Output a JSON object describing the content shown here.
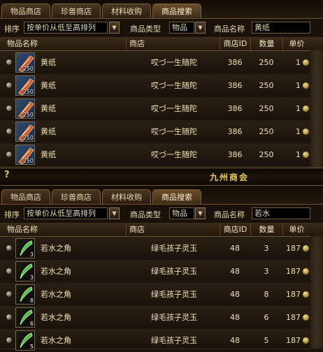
{
  "tabs": [
    "物品商店",
    "珍兽商店",
    "材料收购",
    "商品搜索"
  ],
  "filter": {
    "sort_label": "排序",
    "sort_value": "按单价从低至高排列",
    "type_label": "商品类型",
    "type_value": "物品",
    "name_label": "商品名称"
  },
  "columns": {
    "item": "物品名称",
    "shop": "商店",
    "shop_id": "商店ID",
    "quantity": "数量",
    "price": "单价"
  },
  "top": {
    "search_value": "黄纸",
    "rows": [
      {
        "stack": "250",
        "name": "黄纸",
        "shop": "哎づ一生随陀",
        "shop_id": "386",
        "quantity": "250",
        "price": "1"
      },
      {
        "stack": "250",
        "name": "黄纸",
        "shop": "哎づ一生随陀",
        "shop_id": "386",
        "quantity": "250",
        "price": "1"
      },
      {
        "stack": "250",
        "name": "黄纸",
        "shop": "哎づ一生随陀",
        "shop_id": "386",
        "quantity": "250",
        "price": "1"
      },
      {
        "stack": "250",
        "name": "黄纸",
        "shop": "哎づ一生随陀",
        "shop_id": "386",
        "quantity": "250",
        "price": "1"
      },
      {
        "stack": "250",
        "name": "黄纸",
        "shop": "哎づ一生随陀",
        "shop_id": "386",
        "quantity": "250",
        "price": "1"
      }
    ]
  },
  "divider": {
    "help": "?",
    "chamber_name": "九州商会"
  },
  "bottom": {
    "search_value": "若水",
    "rows": [
      {
        "stack": "3",
        "name": "若水之角",
        "shop": "绿毛孩子灵玉",
        "shop_id": "48",
        "quantity": "3",
        "price": "187"
      },
      {
        "stack": "3",
        "name": "若水之角",
        "shop": "绿毛孩子灵玉",
        "shop_id": "48",
        "quantity": "3",
        "price": "187"
      },
      {
        "stack": "8",
        "name": "若水之角",
        "shop": "绿毛孩子灵玉",
        "shop_id": "48",
        "quantity": "8",
        "price": "187"
      },
      {
        "stack": "6",
        "name": "若水之角",
        "shop": "绿毛孩子灵玉",
        "shop_id": "48",
        "quantity": "6",
        "price": "187"
      },
      {
        "stack": "5",
        "name": "若水之角",
        "shop": "绿毛孩子灵玉",
        "shop_id": "48",
        "quantity": "5",
        "price": "187"
      }
    ]
  }
}
